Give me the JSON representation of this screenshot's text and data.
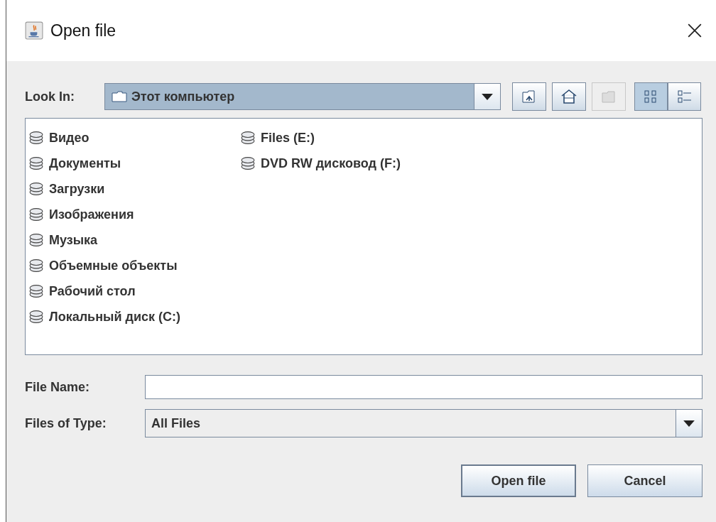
{
  "window": {
    "title": "Open file"
  },
  "look_in": {
    "label": "Look In:",
    "value": "Этот компьютер"
  },
  "toolbar": [
    {
      "kind": "up",
      "disabled": false
    },
    {
      "kind": "home",
      "disabled": false
    },
    {
      "kind": "new-folder",
      "disabled": true
    },
    {
      "kind": "list",
      "selected": true
    },
    {
      "kind": "details",
      "selected": false
    }
  ],
  "files": [
    {
      "name": "Видео"
    },
    {
      "name": "Документы"
    },
    {
      "name": "Загрузки"
    },
    {
      "name": "Изображения"
    },
    {
      "name": "Музыка"
    },
    {
      "name": "Объемные объекты"
    },
    {
      "name": "Рабочий стол"
    },
    {
      "name": "Локальный диск (C:)"
    },
    {
      "name": "Files (E:)"
    },
    {
      "name": "DVD RW дисковод (F:)"
    }
  ],
  "file_name": {
    "label": "File Name:"
  },
  "file_type": {
    "label": "Files of Type:",
    "value": "All Files"
  },
  "buttons": [
    {
      "label": "Open file",
      "default": true
    },
    {
      "label": "Cancel",
      "default": false
    }
  ]
}
